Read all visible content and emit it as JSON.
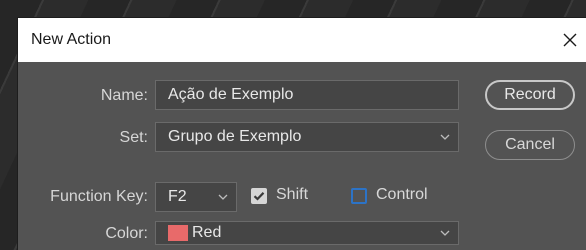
{
  "dialog": {
    "title": "New Action",
    "close_icon": "close-icon"
  },
  "form": {
    "name": {
      "label": "Name:",
      "value": "Ação de Exemplo"
    },
    "set": {
      "label": "Set:",
      "value": "Grupo de Exemplo"
    },
    "function_key": {
      "label": "Function Key:",
      "value": "F2",
      "shift": {
        "label": "Shift",
        "checked": true
      },
      "control": {
        "label": "Control",
        "checked": false
      }
    },
    "color": {
      "label": "Color:",
      "value": "Red",
      "swatch": "#e86a6a"
    }
  },
  "buttons": {
    "record": "Record",
    "cancel": "Cancel"
  },
  "colors": {
    "dialog_bg": "#535353",
    "field_bg": "#454545",
    "checkbox_accent": "#2c73c6"
  }
}
